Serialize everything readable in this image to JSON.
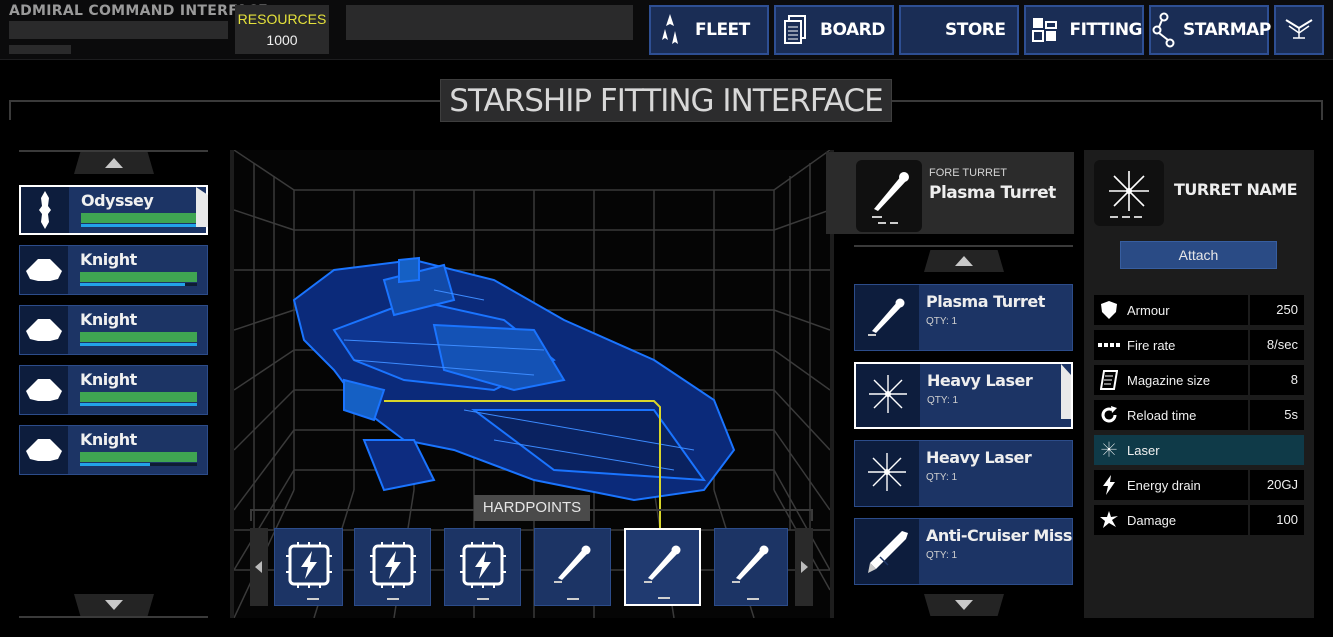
{
  "header": {
    "app_title": "ADMIRAL COMMAND INTERFACE",
    "resources_label": "RESOURCES",
    "resources_value": "1000"
  },
  "nav": [
    {
      "label": "FLEET",
      "icon": "fleet-icon"
    },
    {
      "label": "BOARD",
      "icon": "board-icon"
    },
    {
      "label": "STORE",
      "icon": "store-icon"
    },
    {
      "label": "FITTING",
      "icon": "fitting-icon"
    },
    {
      "label": "STARMAP",
      "icon": "starmap-icon"
    },
    {
      "label": "",
      "icon": "admiral-insignia-icon"
    }
  ],
  "page_title": "STARSHIP FITTING INTERFACE",
  "ships": [
    {
      "name": "Odyssey",
      "hp": 1.0,
      "shield": 1.0,
      "selected": true
    },
    {
      "name": "Knight",
      "hp": 1.0,
      "shield": 0.9
    },
    {
      "name": "Knight",
      "hp": 1.0,
      "shield": 1.0
    },
    {
      "name": "Knight",
      "hp": 1.0,
      "shield": 1.0
    },
    {
      "name": "Knight",
      "hp": 1.0,
      "shield": 0.6
    }
  ],
  "hardpoints": {
    "label": "HARDPOINTS",
    "slots": [
      {
        "type": "power",
        "icon": "power-chip-icon"
      },
      {
        "type": "power",
        "icon": "power-chip-icon"
      },
      {
        "type": "power",
        "icon": "power-chip-icon"
      },
      {
        "type": "turret",
        "icon": "turret-icon"
      },
      {
        "type": "turret",
        "icon": "turret-icon",
        "selected": true
      },
      {
        "type": "turret",
        "icon": "turret-icon"
      }
    ]
  },
  "selected_slot": {
    "slot_name": "FORE TURRET",
    "turret_name": "Plasma Turret"
  },
  "turrets": [
    {
      "name": "Plasma Turret",
      "qty": "QTY: 1",
      "icon": "turret-icon"
    },
    {
      "name": "Heavy Laser",
      "qty": "QTY: 1",
      "icon": "laser-burst-icon",
      "selected": true
    },
    {
      "name": "Heavy Laser",
      "qty": "QTY: 1",
      "icon": "laser-burst-icon"
    },
    {
      "name": "Anti-Cruiser Missile Lau",
      "qty": "QTY: 1",
      "icon": "missile-icon"
    }
  ],
  "details": {
    "title": "TURRET NAME",
    "attach_label": "Attach",
    "stats": [
      {
        "label": "Armour",
        "value": "250",
        "icon": "shield-icon"
      },
      {
        "label": "Fire rate",
        "value": "8/sec",
        "icon": "fire-rate-icon"
      },
      {
        "label": "Magazine size",
        "value": "8",
        "icon": "magazine-icon"
      },
      {
        "label": "Reload time",
        "value": "5s",
        "icon": "reload-icon"
      },
      {
        "label": "Laser",
        "value": "",
        "icon": "laser-burst-icon",
        "highlight": true
      },
      {
        "label": "Energy drain",
        "value": "20GJ",
        "icon": "lightning-icon"
      },
      {
        "label": "Damage",
        "value": "100",
        "icon": "damage-icon"
      }
    ]
  },
  "colors": {
    "card_blue": "#1c3465",
    "nav_border": "#2e4f93",
    "resources_yellow": "#e4e13b",
    "hp_green": "#3fa552",
    "shield_cyan": "#22a2e8",
    "highlight_teal": "#0f3a48",
    "ship_glow": "#1a74ff"
  }
}
